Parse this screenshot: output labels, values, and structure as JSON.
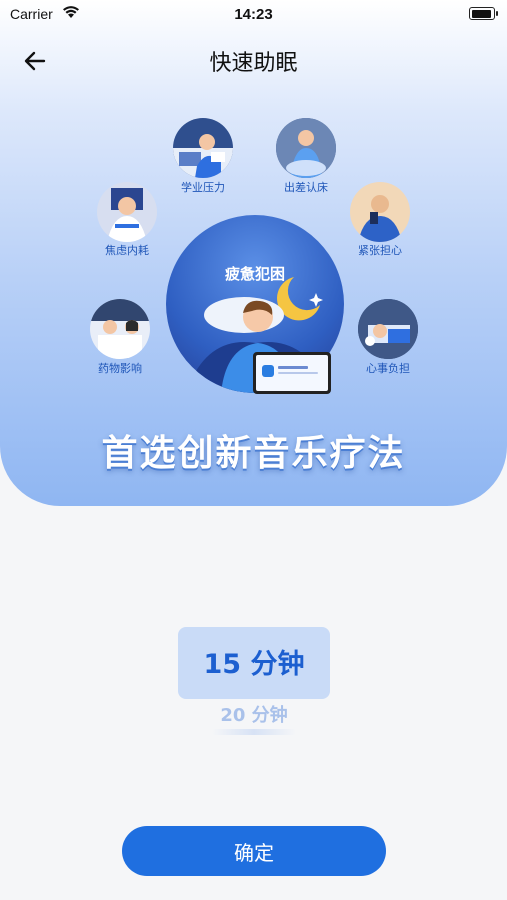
{
  "status_bar": {
    "carrier": "Carrier",
    "time": "14:23"
  },
  "header": {
    "title": "快速助眠"
  },
  "hero": {
    "center_label": "疲惫犯困",
    "bubbles": [
      {
        "label": "学业压力",
        "icon": "student-study-icon"
      },
      {
        "label": "出差认床",
        "icon": "travel-bed-icon"
      },
      {
        "label": "焦虑内耗",
        "icon": "anxiety-icon"
      },
      {
        "label": "紧张担心",
        "icon": "nervous-icon"
      },
      {
        "label": "药物影响",
        "icon": "medication-icon"
      },
      {
        "label": "心事负担",
        "icon": "worry-icon"
      }
    ],
    "slogan": "首选创新音乐疗法"
  },
  "picker": {
    "selected": "15 分钟",
    "next": "20 分钟"
  },
  "confirm_label": "确定",
  "colors": {
    "accent": "#1f6fe0",
    "picker_text": "#1c5fd0",
    "picker_highlight": "#c9dbf7",
    "label_blue": "#1f56b8"
  }
}
